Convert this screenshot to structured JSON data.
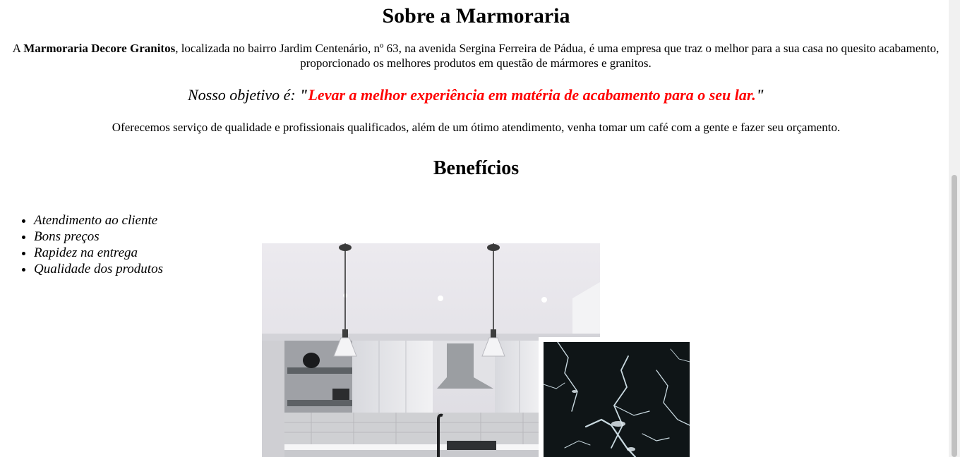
{
  "about": {
    "title": "Sobre a Marmoraria",
    "intro_prefix": "A ",
    "company_name": "Marmoraria Decore Granitos",
    "intro_rest": ", localizada no bairro Jardim Centenário, nº 63, na avenida Sergina Ferreira de Pádua, é uma empresa que traz o melhor para a sua casa no quesito acabamento, proporcionado os melhores produtos em questão de mármores e granitos.",
    "objective_label": "Nosso objetivo é: ",
    "objective_open_quote": "\"",
    "objective_text": "Levar a melhor experiência em matéria de acabamento para o seu lar.",
    "objective_close_quote": "\"",
    "offer": "Oferecemos serviço de qualidade e profissionais qualificados, além de um ótimo atendimento, venha tomar um café com a gente e fazer seu orçamento."
  },
  "benefits": {
    "title": "Benefícios",
    "items": [
      "Atendimento ao cliente",
      "Bons preços",
      "Rapidez na entrega",
      "Qualidade dos produtos"
    ]
  },
  "colors": {
    "objective_highlight": "#ff0000",
    "granite_base": "#0f1517",
    "kitchen_wall": "#e9e9ec"
  }
}
